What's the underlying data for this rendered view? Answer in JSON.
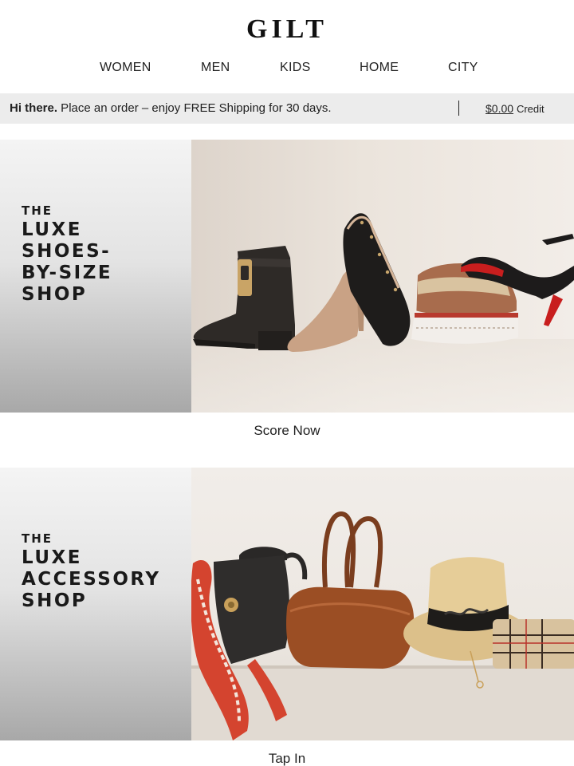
{
  "header": {
    "logo": "GILT"
  },
  "nav": {
    "items": [
      "WOMEN",
      "MEN",
      "KIDS",
      "HOME",
      "CITY"
    ]
  },
  "promo": {
    "greeting": "Hi there.",
    "message": " Place an order – enjoy FREE Shipping for 30 days.",
    "credit_amount": "$0.00",
    "credit_label": "Credit"
  },
  "banners": [
    {
      "title_lines": [
        "THE",
        "LUXE",
        "SHOES-",
        "BY-SIZE",
        "SHOP"
      ],
      "image": "luxe-shoes-photo",
      "cta": "Score Now"
    },
    {
      "title_lines": [
        "THE",
        "LUXE",
        "ACCESSORY",
        "SHOP"
      ],
      "image": "luxe-accessories-photo",
      "cta": "Tap In"
    }
  ],
  "colors": {
    "promo_bar": "#ececec",
    "text": "#222222",
    "sole_red": "#c81e1e"
  }
}
